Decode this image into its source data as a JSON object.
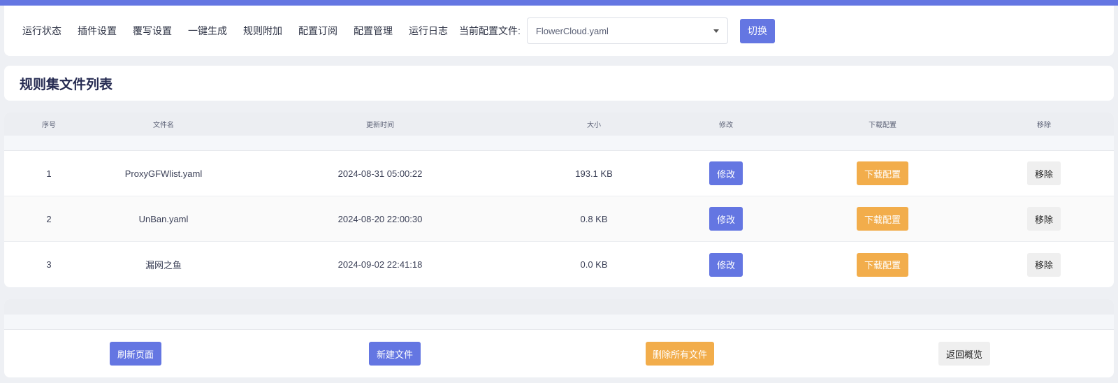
{
  "nav": {
    "items": [
      "运行状态",
      "插件设置",
      "覆写设置",
      "一键生成",
      "规则附加",
      "配置订阅",
      "配置管理",
      "运行日志"
    ],
    "config_label": "当前配置文件:",
    "config_value": "FlowerCloud.yaml",
    "switch_label": "切换"
  },
  "page_title": "规则集文件列表",
  "table": {
    "headers": [
      "序号",
      "文件名",
      "更新时间",
      "大小",
      "修改",
      "下载配置",
      "移除"
    ],
    "rows": [
      {
        "index": "1",
        "name": "ProxyGFWlist.yaml",
        "updated": "2024-08-31 05:00:22",
        "size": "193.1 KB"
      },
      {
        "index": "2",
        "name": "UnBan.yaml",
        "updated": "2024-08-20 22:00:30",
        "size": "0.8 KB"
      },
      {
        "index": "3",
        "name": "漏网之鱼",
        "updated": "2024-09-02 22:41:18",
        "size": "0.0 KB"
      }
    ],
    "edit_label": "修改",
    "download_label": "下载配置",
    "remove_label": "移除"
  },
  "footer": {
    "refresh_label": "刷新页面",
    "new_label": "新建文件",
    "delete_all_label": "删除所有文件",
    "back_label": "返回概览"
  },
  "colors": {
    "primary": "#6476e2",
    "warning": "#f2ad4b",
    "neutral": "#efefef"
  }
}
